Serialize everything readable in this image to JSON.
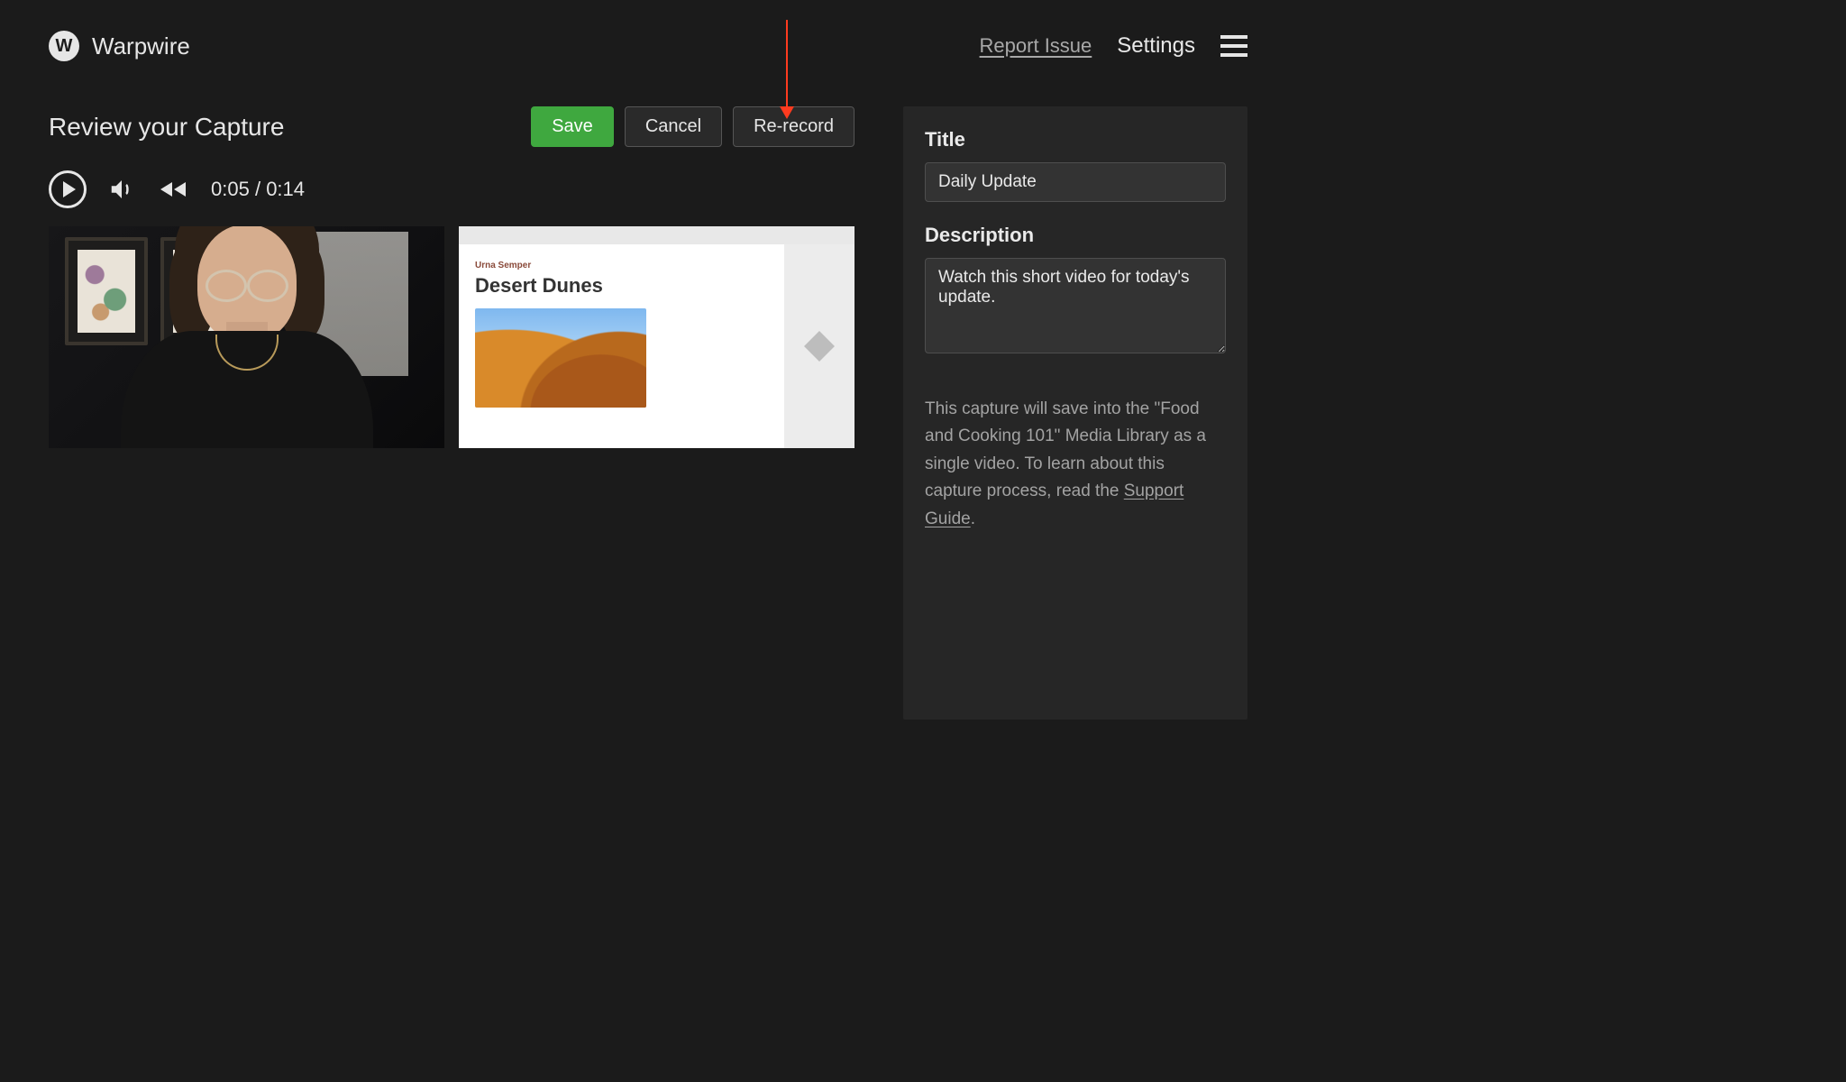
{
  "brand": {
    "logo_letter": "W",
    "name": "Warpwire"
  },
  "header": {
    "report": "Report Issue",
    "settings": "Settings"
  },
  "page": {
    "title": "Review your Capture"
  },
  "actions": {
    "save": "Save",
    "cancel": "Cancel",
    "rerecord": "Re-record"
  },
  "player": {
    "time_current": "0:05",
    "time_total": "0:14"
  },
  "previews": {
    "screen_slide": {
      "subtitle": "Urna Semper",
      "title": "Desert Dunes"
    }
  },
  "side": {
    "title_label": "Title",
    "title_value": "Daily Update",
    "desc_label": "Description",
    "desc_value": "Watch this short video for today's update.",
    "hint_before": "This capture will save into the \"Food and Cooking 101\" Media Library as a single video. To learn about this capture process, read the ",
    "hint_link": "Support Guide",
    "hint_after": "."
  }
}
